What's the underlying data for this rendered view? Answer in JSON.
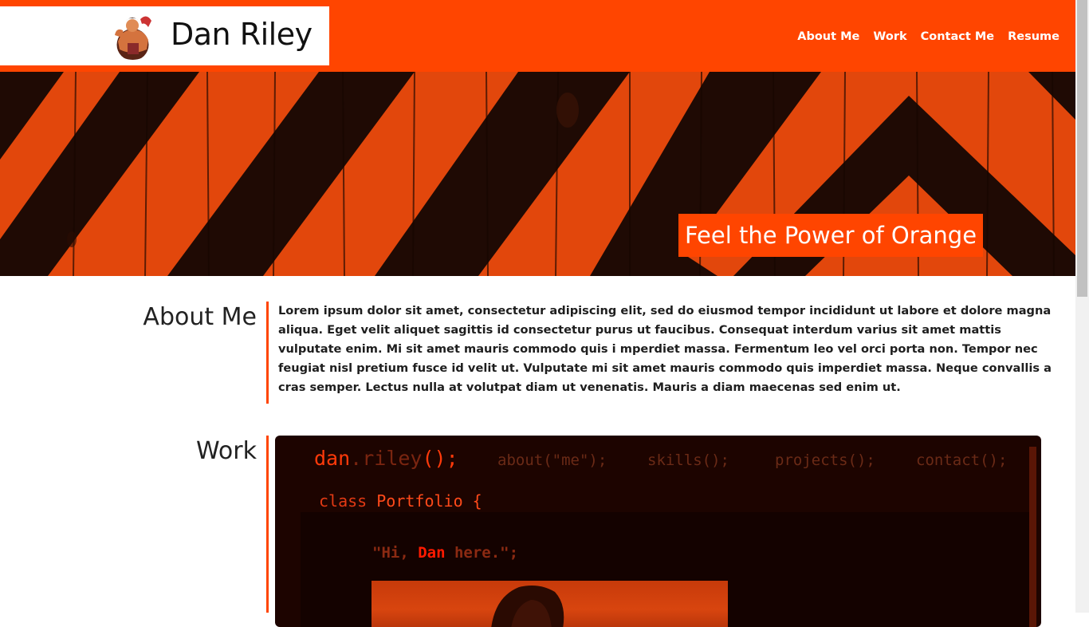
{
  "header": {
    "brand_name": "Dan Riley",
    "nav": [
      "About Me",
      "Work",
      "Contact Me",
      "Resume"
    ]
  },
  "hero": {
    "tagline": "Feel the Power of Orange"
  },
  "about": {
    "title": "About Me",
    "text": "Lorem ipsum dolor sit amet, consectetur adipiscing elit, sed do eiusmod tempor incididunt ut labore et dolore magna aliqua. Eget velit aliquet sagittis id consectetur purus ut faucibus. Consequat interdum varius sit amet mattis vulputate enim. Mi sit amet mauris commodo quis i mperdiet massa. Fermentum leo vel orci porta non. Tempor nec feugiat nisl pretium fusce id velit ut. Vulputate mi sit amet mauris commodo quis imperdiet massa. Neque convallis a cras semper. Lectus nulla at volutpat diam ut venenatis. Mauris a diam maecenas sed enim ut."
  },
  "work": {
    "title": "Work",
    "screen": {
      "logo_name": "dan",
      "logo_dot": ".",
      "logo_rest": "riley",
      "logo_parens": "();",
      "nav": [
        "about(\"me\");",
        "skills();",
        "projects();",
        "contact();"
      ],
      "class_keyword": "class",
      "class_name": "Portfolio {",
      "hi_prefix": "\"Hi, ",
      "hi_name": "Dan",
      "hi_suffix": " here.\";"
    }
  },
  "colors": {
    "accent": "#ff4500",
    "text": "#1e1e1e",
    "screen_bg": "#1d0400"
  },
  "icons": {
    "avatar": "avatar-strongman-icon"
  }
}
